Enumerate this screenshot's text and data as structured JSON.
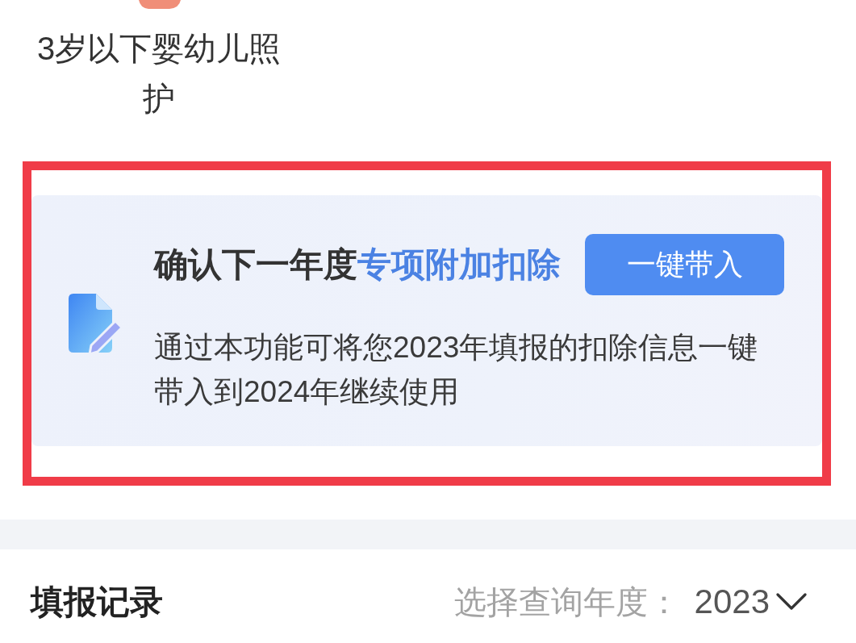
{
  "category_item": {
    "label": "3岁以下婴幼儿照护"
  },
  "carry_over_card": {
    "highlighted": true,
    "title_parts": [
      {
        "kind": "plain",
        "text": "确认下一年度"
      },
      {
        "kind": "accent",
        "text": "专项附加扣除"
      }
    ],
    "button": "一键带入",
    "description": "通过本功能可将您2023年填报的扣除信息一键带入到2024年继续使用"
  },
  "records_section": {
    "title": "填报记录",
    "year_filter": {
      "label": "选择查询年度：",
      "value": "2023"
    }
  }
}
